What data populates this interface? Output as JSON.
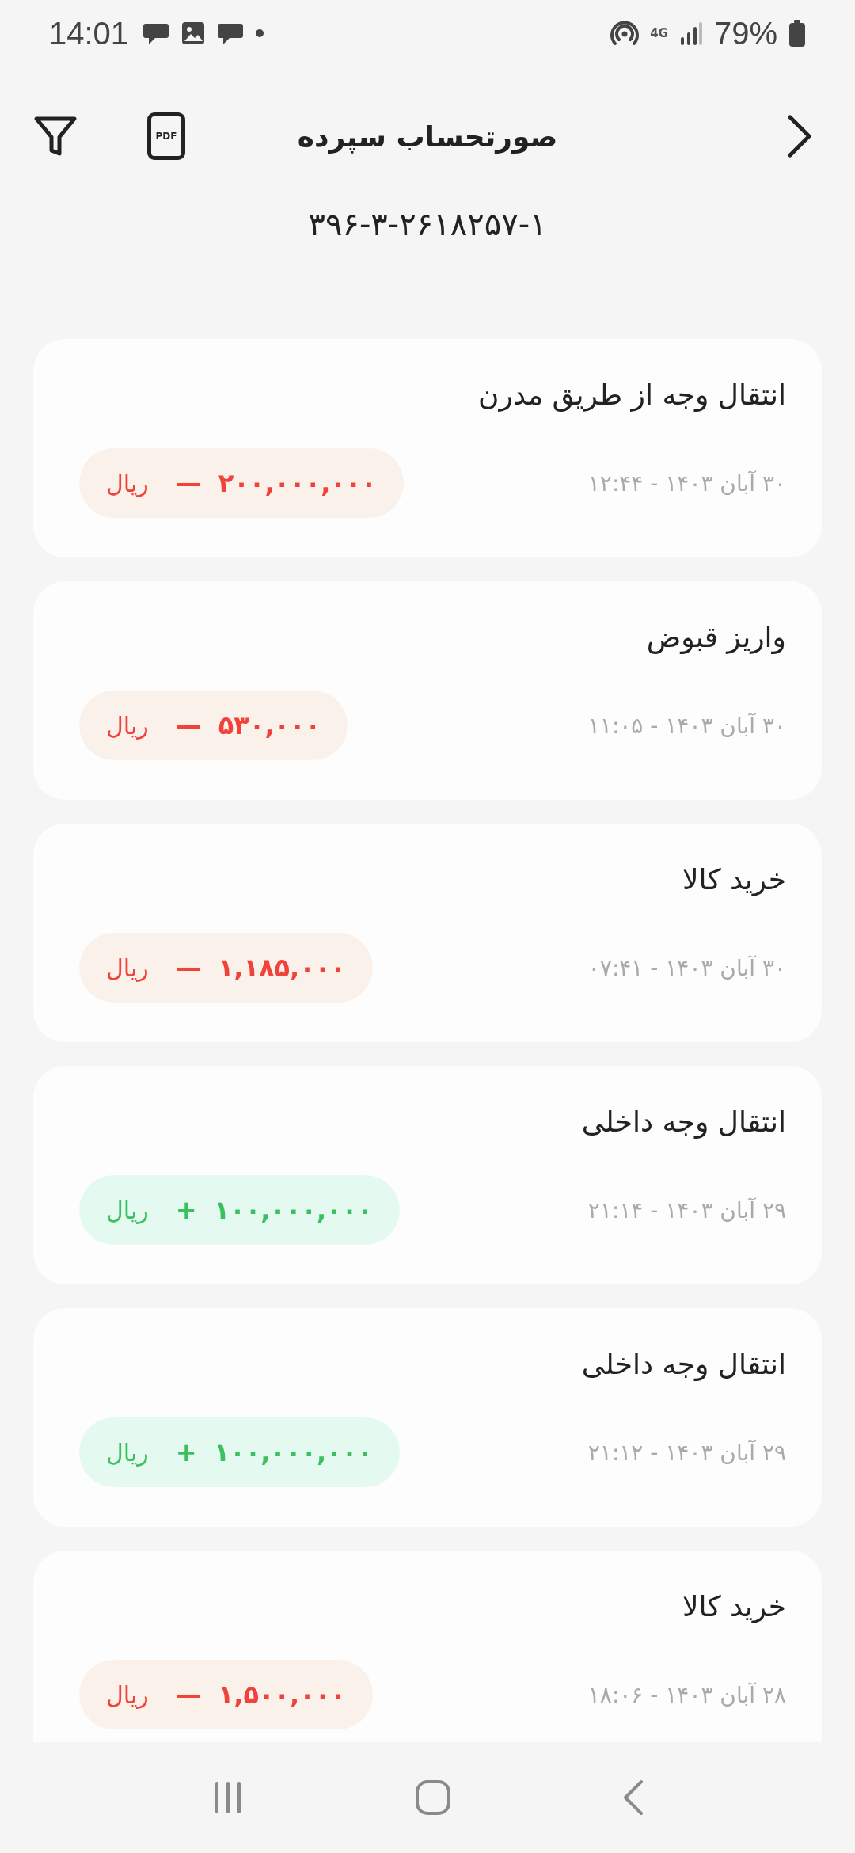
{
  "status_bar": {
    "time": "14:01",
    "battery": "79%",
    "network": "4G"
  },
  "header": {
    "title": "صورتحساب سپرده",
    "pdf_label": "PDF"
  },
  "account_number": "۳۹۶-۳-۲۶۱۸۲۵۷-۱",
  "transactions": [
    {
      "title": "انتقال وجه از طریق مدرن",
      "date": "۳۰ آبان ۱۴۰۳ - ۱۲:۴۴",
      "kind": "debit",
      "sign": "—",
      "amount": "۲۰۰,۰۰۰,۰۰۰",
      "currency": "ریال"
    },
    {
      "title": "واریز قبوض",
      "date": "۳۰ آبان ۱۴۰۳ - ۱۱:۰۵",
      "kind": "debit",
      "sign": "—",
      "amount": "۵۳۰,۰۰۰",
      "currency": "ریال"
    },
    {
      "title": "خرید کالا",
      "date": "۳۰ آبان ۱۴۰۳ - ۰۷:۴۱",
      "kind": "debit",
      "sign": "—",
      "amount": "۱,۱۸۵,۰۰۰",
      "currency": "ریال"
    },
    {
      "title": "انتقال وجه داخلی",
      "date": "۲۹ آبان ۱۴۰۳ - ۲۱:۱۴",
      "kind": "credit",
      "sign": "+",
      "amount": "۱۰۰,۰۰۰,۰۰۰",
      "currency": "ریال"
    },
    {
      "title": "انتقال وجه داخلی",
      "date": "۲۹ آبان ۱۴۰۳ - ۲۱:۱۲",
      "kind": "credit",
      "sign": "+",
      "amount": "۱۰۰,۰۰۰,۰۰۰",
      "currency": "ریال"
    },
    {
      "title": "خرید کالا",
      "date": "۲۸ آبان ۱۴۰۳ - ۱۸:۰۶",
      "kind": "debit",
      "sign": "—",
      "amount": "۱,۵۰۰,۰۰۰",
      "currency": "ریال"
    }
  ]
}
